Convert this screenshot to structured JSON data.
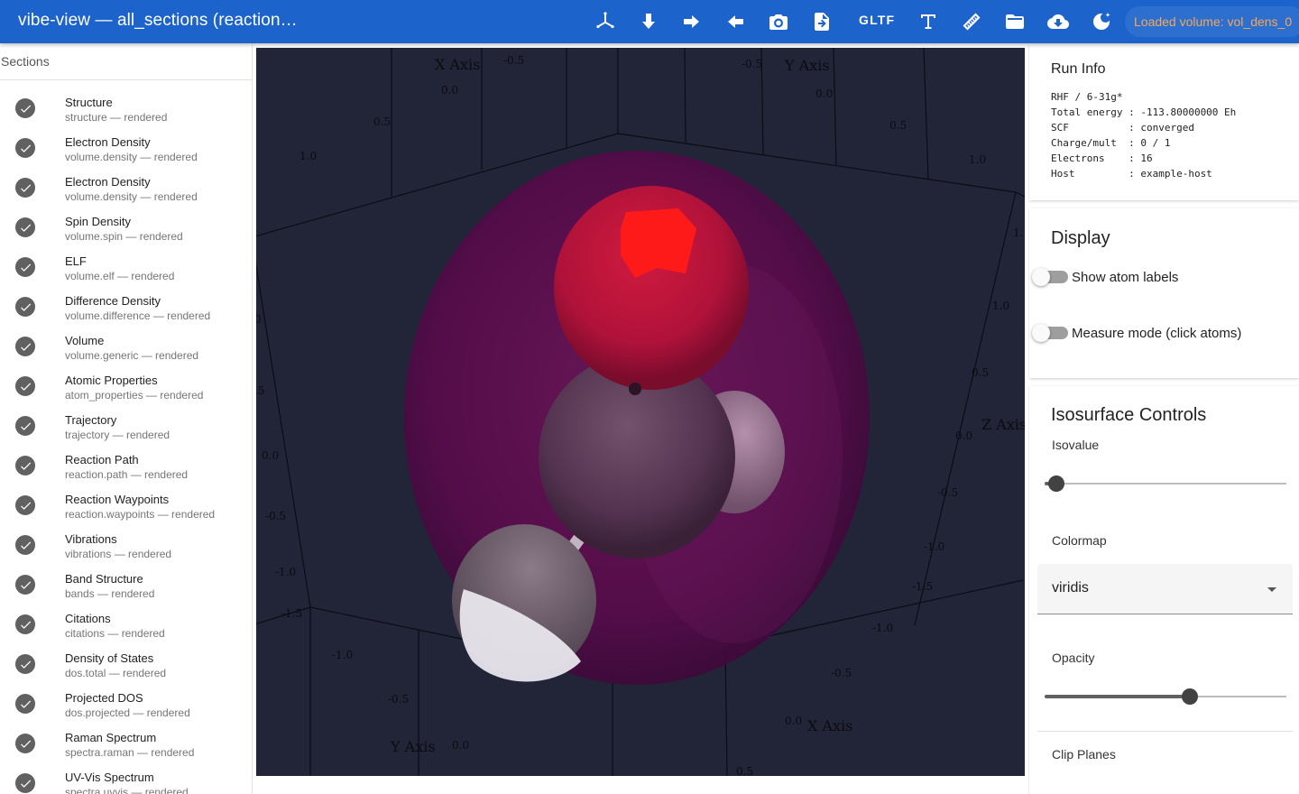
{
  "app": {
    "title": "vibe-view — all_sections (reaction…",
    "gltf_label": "GLTF",
    "status_chip": "Loaded volume: vol_dens_0",
    "toolbar_icons": [
      "axes-icon",
      "arrow-down-icon",
      "arrow-right-icon",
      "arrow-left-icon",
      "camera-icon",
      "export-file-icon",
      "text-icon",
      "ruler-icon",
      "folder-open-icon",
      "cloud-download-icon",
      "theme-toggle-icon"
    ]
  },
  "sidebar": {
    "header": "Sections",
    "items": [
      {
        "title": "Structure",
        "subtitle": "structure — rendered"
      },
      {
        "title": "Electron Density",
        "subtitle": "volume.density — rendered"
      },
      {
        "title": "Electron Density",
        "subtitle": "volume.density — rendered"
      },
      {
        "title": "Spin Density",
        "subtitle": "volume.spin — rendered"
      },
      {
        "title": "ELF",
        "subtitle": "volume.elf — rendered"
      },
      {
        "title": "Difference Density",
        "subtitle": "volume.difference — rendered"
      },
      {
        "title": "Volume",
        "subtitle": "volume.generic — rendered"
      },
      {
        "title": "Atomic Properties",
        "subtitle": "atom_properties — rendered"
      },
      {
        "title": "Trajectory",
        "subtitle": "trajectory — rendered"
      },
      {
        "title": "Reaction Path",
        "subtitle": "reaction.path — rendered"
      },
      {
        "title": "Reaction Waypoints",
        "subtitle": "reaction.waypoints — rendered"
      },
      {
        "title": "Vibrations",
        "subtitle": "vibrations — rendered"
      },
      {
        "title": "Band Structure",
        "subtitle": "bands — rendered"
      },
      {
        "title": "Citations",
        "subtitle": "citations — rendered"
      },
      {
        "title": "Density of States",
        "subtitle": "dos.total — rendered"
      },
      {
        "title": "Projected DOS",
        "subtitle": "dos.projected — rendered"
      },
      {
        "title": "Raman Spectrum",
        "subtitle": "spectra.raman — rendered"
      },
      {
        "title": "UV-Vis Spectrum",
        "subtitle": "spectra.uvvis — rendered"
      }
    ]
  },
  "viewport": {
    "axis_titles": {
      "x_top": "X Axis",
      "y_top": "Y Axis",
      "z_right": "Z Axis",
      "x_bottom": "X Axis",
      "y_bottom": "Y Axis"
    },
    "tick_labels": {
      "x_top": [
        "-0.5",
        "0.0",
        "0.5",
        "1.0"
      ],
      "y_top": [
        "-0.5",
        "0.0",
        "0.5",
        "1.0"
      ],
      "z_right": [
        "1.0",
        "0.5",
        "0.0",
        "-0.5",
        "-1.0",
        "-1.5"
      ],
      "z_right_outer": [
        "1.",
        "-1.0"
      ],
      "left_column": [
        "0.0",
        "-0.5",
        "-1.0",
        "-1.5"
      ],
      "left_partial": [
        "0",
        ".5"
      ],
      "y_bottom": [
        "-1.0",
        "-0.5",
        "0.0"
      ],
      "x_bottom": [
        "0.0",
        "-0.5",
        "0.5"
      ]
    },
    "colors": {
      "background": "#222438",
      "isosurface": "#5a0e4d",
      "oxygen": "#c8163a",
      "carbon": "#5d3a55",
      "hydrogen": "#e8e6ec"
    }
  },
  "run_info": {
    "title": "Run Info",
    "lines": [
      "RHF / 6-31g*",
      "Total energy : -113.80000000 Eh",
      "SCF          : converged",
      "Charge/mult  : 0 / 1",
      "Electrons    : 16",
      "Host         : example-host"
    ]
  },
  "display": {
    "title": "Display",
    "show_atom_labels": {
      "label": "Show atom labels",
      "on": false
    },
    "measure_mode": {
      "label": "Measure mode (click atoms)",
      "on": false
    }
  },
  "isosurface": {
    "title": "Isosurface Controls",
    "isovalue_label": "Isovalue",
    "isovalue_fraction": 0.05,
    "colormap_label": "Colormap",
    "colormap_value": "viridis",
    "opacity_label": "Opacity",
    "opacity_fraction": 0.6,
    "clip_planes_label": "Clip Planes"
  }
}
